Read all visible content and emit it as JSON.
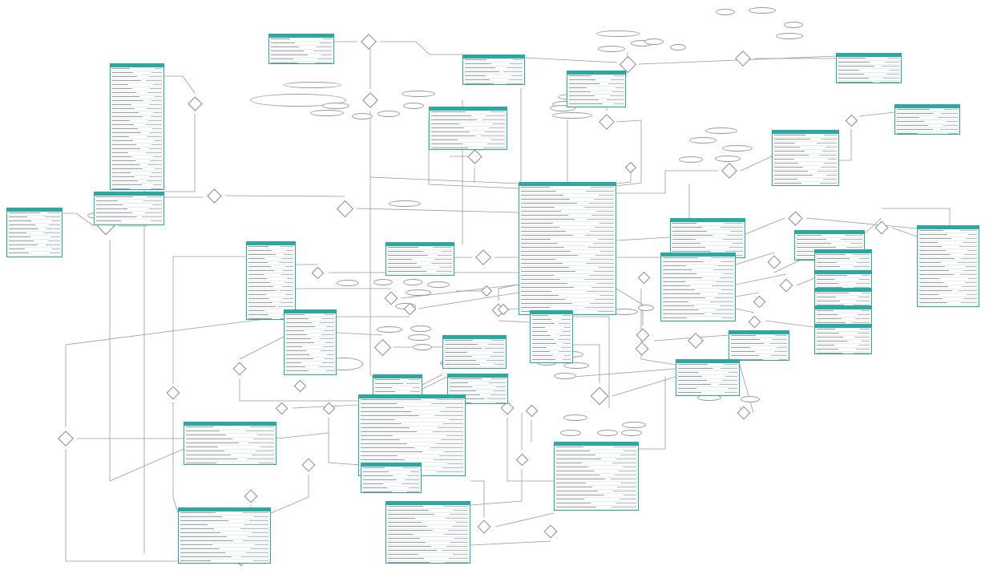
{
  "diagram": {
    "type": "entity-relationship",
    "theme": {
      "entity_header": "#2aa8a2",
      "entity_border": "#2aa8a2",
      "line": "#9a9a9a",
      "shape_border": "#8a8a8a"
    },
    "note": "",
    "entities": [
      {
        "id": "e1"
      },
      {
        "id": "e2"
      },
      {
        "id": "e3"
      },
      {
        "id": "e4"
      },
      {
        "id": "e5"
      },
      {
        "id": "e6"
      },
      {
        "id": "e7"
      },
      {
        "id": "e8"
      },
      {
        "id": "e9"
      },
      {
        "id": "e10"
      },
      {
        "id": "e11"
      },
      {
        "id": "e12"
      },
      {
        "id": "e13"
      },
      {
        "id": "e14"
      },
      {
        "id": "e15"
      },
      {
        "id": "e16"
      },
      {
        "id": "e17"
      },
      {
        "id": "e18"
      },
      {
        "id": "e19"
      },
      {
        "id": "e20"
      },
      {
        "id": "e21"
      },
      {
        "id": "e22"
      },
      {
        "id": "e23"
      },
      {
        "id": "e24"
      },
      {
        "id": "e25"
      },
      {
        "id": "e26"
      },
      {
        "id": "e27"
      },
      {
        "id": "e28"
      },
      {
        "id": "e29"
      },
      {
        "id": "e30"
      },
      {
        "id": "e31"
      },
      {
        "id": "e32"
      }
    ]
  }
}
